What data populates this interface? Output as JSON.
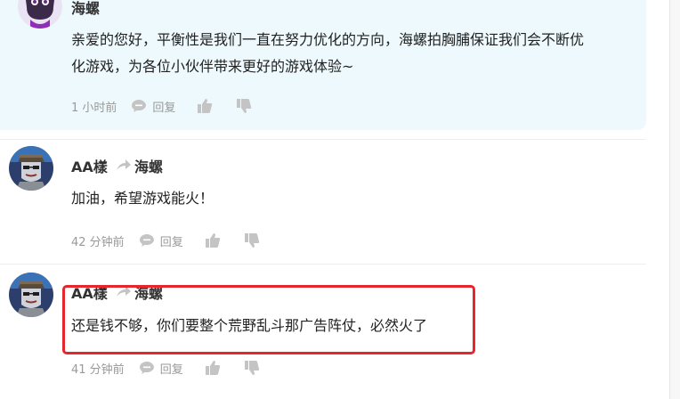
{
  "comments": [
    {
      "author": "海螺",
      "text_lines": [
        "亲爱的您好，平衡性是我们一直在努力优化的方向，海螺拍胸脯保证我们会不断优",
        "化游戏，为各位小伙伴带来更好的游戏体验~"
      ],
      "time": "1 小时前",
      "reply_label": "回复",
      "avatar": "official-avatar-icon"
    },
    {
      "author": "AA樣",
      "reply_to": "海螺",
      "text_lines": [
        "加油，希望游戏能火！"
      ],
      "time": "42 分钟前",
      "reply_label": "回复",
      "avatar": "user-avatar-icon"
    },
    {
      "author": "AA樣",
      "reply_to": "海螺",
      "text_lines": [
        "还是钱不够，你们要整个荒野乱斗那广告阵仗，必然火了"
      ],
      "time": "41 分钟前",
      "reply_label": "回复",
      "avatar": "user-avatar-icon"
    }
  ],
  "colors": {
    "official_bg": "#eef9fd",
    "highlight": "#e5262c",
    "meta_text": "#999999",
    "icon_gray": "#c4c4c4"
  }
}
